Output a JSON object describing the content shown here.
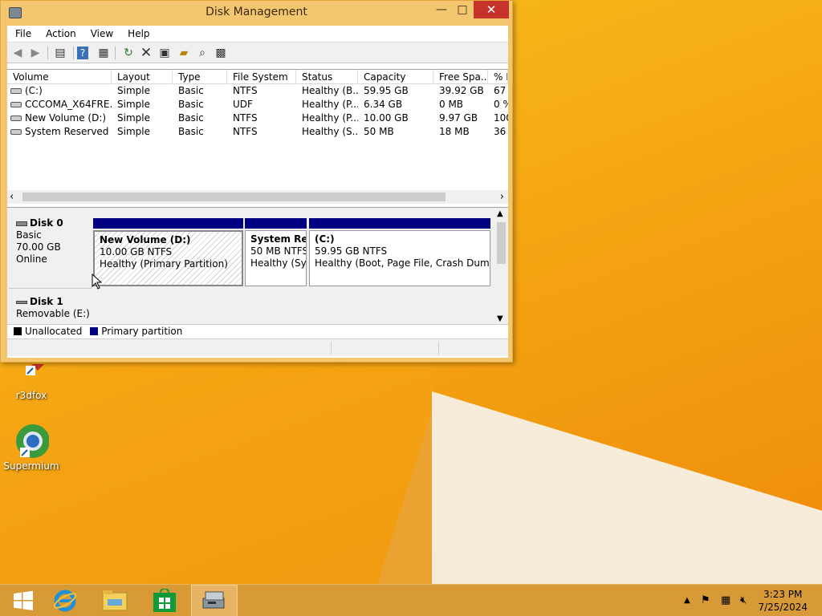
{
  "window": {
    "title": "Disk Management",
    "controls": {
      "minimize": "—",
      "maximize": "□",
      "close": "✕"
    }
  },
  "menu": [
    "File",
    "Action",
    "View",
    "Help"
  ],
  "toolbar": [
    "back-icon",
    "forward-icon",
    "console-tree-icon",
    "help-icon",
    "properties-view-icon",
    "refresh-icon",
    "delete-icon",
    "properties-icon",
    "open-icon",
    "explore-icon",
    "rescan-icon"
  ],
  "volumes": {
    "columns": [
      "Volume",
      "Layout",
      "Type",
      "File System",
      "Status",
      "Capacity",
      "Free Spa...",
      "% F"
    ],
    "rows": [
      {
        "volume": "(C:)",
        "layout": "Simple",
        "type": "Basic",
        "fs": "NTFS",
        "status": "Healthy (B...",
        "capacity": "59.95 GB",
        "free": "39.92 GB",
        "pct": "67"
      },
      {
        "volume": "CCCOMA_X64FRE...",
        "layout": "Simple",
        "type": "Basic",
        "fs": "UDF",
        "status": "Healthy (P...",
        "capacity": "6.34 GB",
        "free": "0 MB",
        "pct": "0 %"
      },
      {
        "volume": "New Volume (D:)",
        "layout": "Simple",
        "type": "Basic",
        "fs": "NTFS",
        "status": "Healthy (P...",
        "capacity": "10.00 GB",
        "free": "9.97 GB",
        "pct": "100"
      },
      {
        "volume": "System Reserved",
        "layout": "Simple",
        "type": "Basic",
        "fs": "NTFS",
        "status": "Healthy (S...",
        "capacity": "50 MB",
        "free": "18 MB",
        "pct": "36"
      }
    ]
  },
  "disks": [
    {
      "name": "Disk 0",
      "type": "Basic",
      "size": "70.00 GB",
      "state": "Online",
      "partitions": [
        {
          "name": "New Volume  (D:)",
          "size": "10.00 GB NTFS",
          "status": "Healthy (Primary Partition)"
        },
        {
          "name": "System Res",
          "size": "50 MB NTFS",
          "status": "Healthy (Sys"
        },
        {
          "name": "(C:)",
          "size": "59.95 GB NTFS",
          "status": "Healthy (Boot, Page File, Crash Dump, P"
        }
      ]
    },
    {
      "name": "Disk 1",
      "type": "Removable (E:)"
    }
  ],
  "legend": [
    {
      "label": "Unallocated",
      "color": "#000000"
    },
    {
      "label": "Primary partition",
      "color": "#000080"
    }
  ],
  "desktop_icons": [
    {
      "label": "r3dfox"
    },
    {
      "label": "Supermium"
    }
  ],
  "taskbar": {
    "items": [
      "start-icon",
      "internet-explorer-icon",
      "file-explorer-icon",
      "store-icon",
      "disk-management-icon"
    ],
    "time": "3:23 PM",
    "date": "7/25/2024"
  }
}
